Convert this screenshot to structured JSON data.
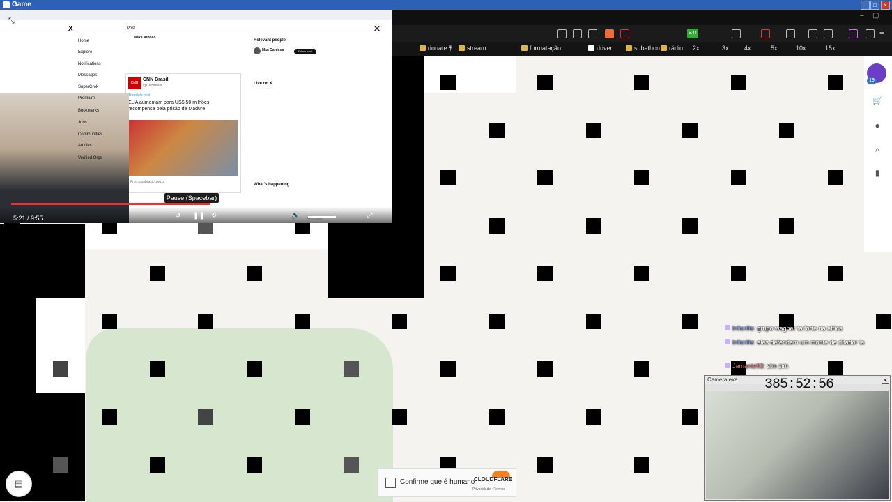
{
  "titlebar": {
    "title": "Game"
  },
  "chrome": {
    "bookmarks": [
      "donate $",
      "stream",
      "formatação",
      "driver",
      "subathon",
      "rádio",
      "2x",
      "3x",
      "4x",
      "5x",
      "10x",
      "15x"
    ],
    "badge_count": "5.44"
  },
  "side_panel": {
    "badge": "19"
  },
  "video": {
    "x_nav": [
      "Home",
      "Explore",
      "Notifications",
      "Messages",
      "SuperGrok",
      "Premium",
      "Bookmarks",
      "Jobs",
      "Communities",
      "Articles",
      "Verified Orgs"
    ],
    "post_header": "Post",
    "author": "Max Cardoso",
    "relevant_people_title": "Relevant people",
    "relevant_person": "Max Cardoso",
    "follow_label": "Follow back",
    "live_title": "Live on X",
    "happening_title": "What's happening",
    "cnn_name": "CNN Brasil",
    "cnn_handle": "@CNNBrasil",
    "translate_label": "Translate post",
    "cnn_headline": "EUA aumentam para US$ 50 milhões recompensa pela prisão de Madure",
    "cnn_source": "From cnnbrasil.com.br",
    "tooltip": "Pause (Spacebar)",
    "time": "5:21 / 9:55",
    "progress": 0.54,
    "messages_label": "Messages"
  },
  "chat": [
    {
      "user": "lnfiorille",
      "text": ": grupo wagner ta forte na africa"
    },
    {
      "user": "lnfiorille",
      "text": ": eles defendem um monte de ditador la"
    },
    {
      "user": "Jamante93",
      "text": ": sim sim"
    }
  ],
  "camera": {
    "title": "Camera.exe",
    "timer": "385:52:56"
  },
  "captcha": {
    "label": "Confirme que é humano",
    "brand": "CLOUDFLARE",
    "links": "Privacidade • Termos"
  }
}
